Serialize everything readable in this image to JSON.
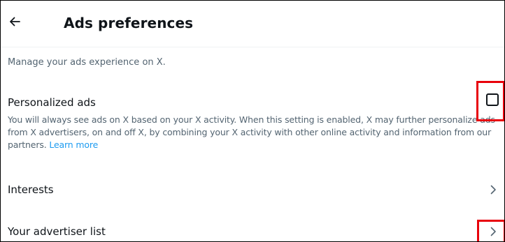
{
  "header": {
    "back_icon": "arrow-left-icon",
    "title": "Ads preferences"
  },
  "intro": {
    "description": "Manage your ads experience on X."
  },
  "personalized_ads": {
    "title": "Personalized ads",
    "body": "You will always see ads on X based on your X activity. When this setting is enabled, X may further personalize ads from X advertisers, on and off X, by combining your X activity with other online activity and information from our partners.",
    "link": "Learn more",
    "checked": false
  },
  "rows": {
    "interests": {
      "label": "Interests",
      "icon": "chevron-right-icon"
    },
    "advertiser_list": {
      "label": "Your advertiser list",
      "icon": "chevron-right-icon"
    }
  },
  "colors": {
    "text": "#0f1419",
    "secondary_text": "#536471",
    "link": "#1d9bf0",
    "highlight": "#e8000b",
    "divider": "#eff3f4"
  }
}
